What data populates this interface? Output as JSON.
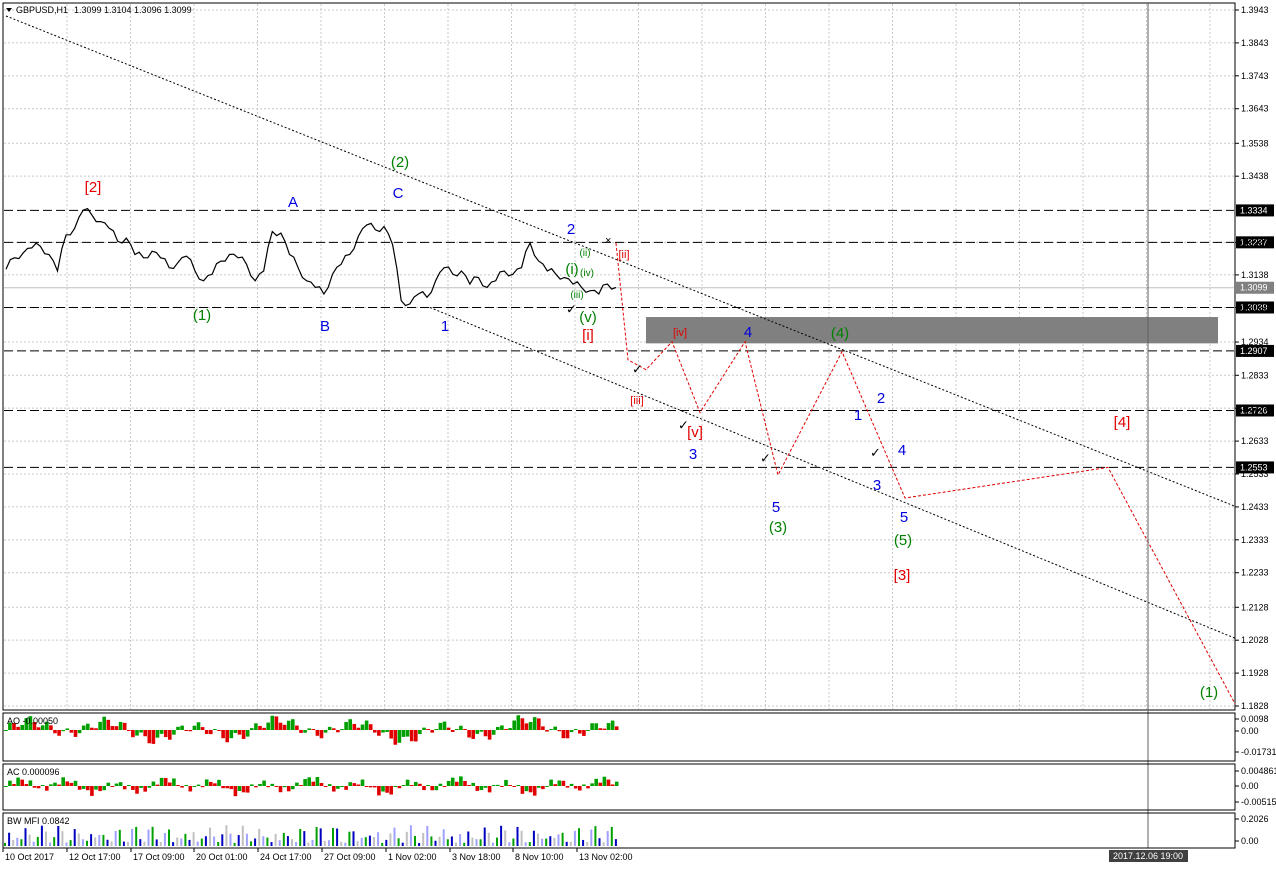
{
  "header": {
    "symbol": "GBPUSD,H1",
    "ohlc": "1.3099 1.3104 1.3096 1.3099"
  },
  "chart_data": {
    "type": "line",
    "title": "GBPUSD,H1 1.3099 1.3104 1.3096 1.3099",
    "y_axis_ticks": [
      "1.3943",
      "1.3843",
      "1.3743",
      "1.3643",
      "1.3538",
      "1.3438",
      "1.3237",
      "1.3138",
      "1.3039",
      "1.2934",
      "1.2833",
      "1.2733",
      "1.2633",
      "1.2533",
      "1.2433",
      "1.2333",
      "1.2233",
      "1.2128",
      "1.2028",
      "1.1928",
      "1.1828"
    ],
    "ylim": [
      1.1828,
      1.3943
    ],
    "x_axis_ticks": [
      "10 Oct 2017",
      "12 Oct 17:00",
      "17 Oct 09:00",
      "20 Oct 01:00",
      "24 Oct 17:00",
      "27 Oct 09:00",
      "1 Nov 02:00",
      "3 Nov 18:00",
      "8 Nov 10:00",
      "13 Nov 02:00"
    ],
    "x_cursor_label": "2017.12.06 19:00",
    "levels": [
      {
        "price": "1.3334",
        "color": "#000000"
      },
      {
        "price": "1.3237",
        "color": "#000000"
      },
      {
        "price": "1.3099",
        "color": "#c0c0c0"
      },
      {
        "price": "1.3039",
        "color": "#000000"
      },
      {
        "price": "1.2907",
        "color": "#000000"
      },
      {
        "price": "1.2726",
        "color": "#000000"
      },
      {
        "price": "1.2553",
        "color": "#000000"
      }
    ],
    "zone": {
      "from": 1.293,
      "to": 1.301
    },
    "series": [
      {
        "values": [
          1.3155,
          1.319,
          1.3205,
          1.322,
          1.3225,
          1.32,
          1.315,
          1.326,
          1.328,
          1.3335,
          1.332,
          1.33,
          1.328,
          1.324,
          1.325,
          1.32,
          1.319,
          1.321,
          1.319,
          1.316,
          1.3175,
          1.3195,
          1.315,
          1.312,
          1.314,
          1.318,
          1.32,
          1.319,
          1.317,
          1.312,
          1.315,
          1.327,
          1.3265,
          1.32,
          1.316,
          1.312,
          1.31,
          1.308,
          1.314,
          1.317,
          1.32,
          1.3255,
          1.329,
          1.3275,
          1.3285,
          1.323,
          1.306,
          1.305,
          1.308,
          1.307,
          1.312,
          1.316,
          1.314,
          1.315,
          1.311,
          1.313,
          1.31,
          1.312,
          1.315,
          1.314,
          1.316,
          1.3235,
          1.318,
          1.315,
          1.314,
          1.313,
          1.311,
          1.31,
          1.309,
          1.308,
          1.311,
          1.31
        ]
      }
    ],
    "projection": [
      [
        1.3235,
        1.305
      ],
      [
        1.2865,
        1.288
      ],
      [
        1.2905,
        1.285
      ],
      [
        1.276,
        1.2935
      ],
      [
        1.2715,
        1.286
      ],
      [
        1.269,
        1.278
      ],
      [
        1.293,
        1.278
      ],
      [
        1.26,
        1.288
      ],
      [
        1.291,
        1.284
      ],
      [
        1.272,
        1.246
      ],
      [
        1.249,
        1.25
      ],
      [
        1.255,
        1.22
      ],
      [
        1.1828,
        1.1828
      ]
    ],
    "wave_labels": [
      {
        "text": "[2]",
        "color": "#e00000"
      },
      {
        "text": "A",
        "color": "#0000e0"
      },
      {
        "text": "(2)",
        "color": "#008000"
      },
      {
        "text": "C",
        "color": "#0000e0"
      },
      {
        "text": "2",
        "color": "#0000e0"
      },
      {
        "text": "(1)",
        "color": "#008000"
      },
      {
        "text": "B",
        "color": "#0000e0"
      },
      {
        "text": "1",
        "color": "#0000e0"
      },
      {
        "text": "(ii)",
        "color": "#008000"
      },
      {
        "text": "(i)",
        "color": "#008000"
      },
      {
        "text": "(iv)",
        "color": "#008000"
      },
      {
        "text": "(iii)",
        "color": "#008000"
      },
      {
        "text": "(v)",
        "color": "#008000"
      },
      {
        "text": "[ii]",
        "color": "#e00000"
      },
      {
        "text": "[i]",
        "color": "#e00000"
      },
      {
        "text": "[iv]",
        "color": "#e00000"
      },
      {
        "text": "[iii]",
        "color": "#e00000"
      },
      {
        "text": "[v]",
        "color": "#e00000"
      },
      {
        "text": "4",
        "color": "#0000e0"
      },
      {
        "text": "(4)",
        "color": "#008000"
      },
      {
        "text": "3",
        "color": "#0000e0"
      },
      {
        "text": "5",
        "color": "#0000e0"
      },
      {
        "text": "(3)",
        "color": "#008000"
      },
      {
        "text": "1",
        "color": "#0000e0"
      },
      {
        "text": "2",
        "color": "#0000e0"
      },
      {
        "text": "4",
        "color": "#0000e0"
      },
      {
        "text": "3",
        "color": "#0000e0"
      },
      {
        "text": "5",
        "color": "#0000e0"
      },
      {
        "text": "(5)",
        "color": "#008000"
      },
      {
        "text": "[3]",
        "color": "#e00000"
      },
      {
        "text": "[4]",
        "color": "#e00000"
      },
      {
        "text": "(1)",
        "color": "#008000"
      }
    ],
    "indicators": [
      {
        "name": "AO -0.00050",
        "ticks": [
          "0.0098",
          "0.00",
          "-0.01731"
        ]
      },
      {
        "name": "AC 0.000096",
        "ticks": [
          "0.004861",
          "0.00",
          "-0.00515"
        ]
      },
      {
        "name": "BW MFI 0.0842",
        "ticks": [
          "0.2026",
          "0.00"
        ]
      }
    ],
    "colors": {
      "up": "#00a000",
      "down": "#e00000",
      "mfi_blue": "#0000c0",
      "price": "#000000",
      "projection": "#e00000"
    }
  }
}
